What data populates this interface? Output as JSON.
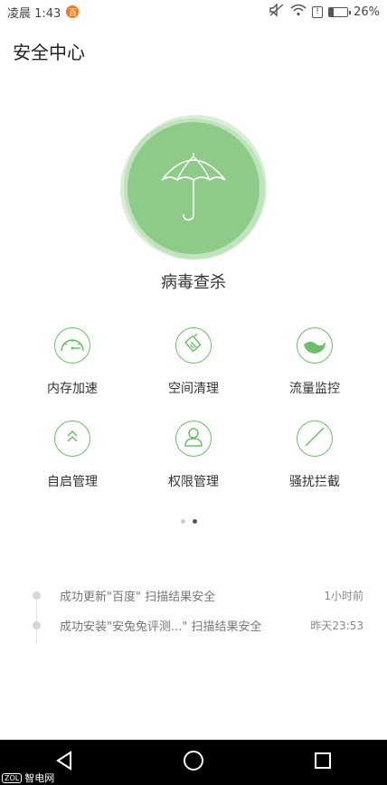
{
  "status_bar": {
    "time": "凌晨 1:43",
    "notification_badge": "百",
    "battery_percent": "26%",
    "battery_level": 0.26,
    "alert_icon": "!"
  },
  "header": {
    "title": "安全中心"
  },
  "hero": {
    "label": "病毒查杀",
    "icon": "umbrella-icon",
    "color": "#8ecb88"
  },
  "tools": [
    {
      "label": "内存加速",
      "icon": "speedometer-icon"
    },
    {
      "label": "空间清理",
      "icon": "broom-icon"
    },
    {
      "label": "流量监控",
      "icon": "data-wave-icon"
    },
    {
      "label": "自启管理",
      "icon": "double-chevron-up-icon"
    },
    {
      "label": "权限管理",
      "icon": "user-icon"
    },
    {
      "label": "骚扰拦截",
      "icon": "block-icon"
    }
  ],
  "accent_color": "#6dbd6a",
  "pager": {
    "count": 2,
    "active": 2
  },
  "log": [
    {
      "message": "成功更新\"百度\" 扫描结果安全",
      "time": "1小时前"
    },
    {
      "message": "成功安装\"安兔兔评测...\" 扫描结果安全",
      "time": "昨天23:53"
    }
  ],
  "watermark": {
    "logo": "ZOL",
    "text": "智电网"
  }
}
